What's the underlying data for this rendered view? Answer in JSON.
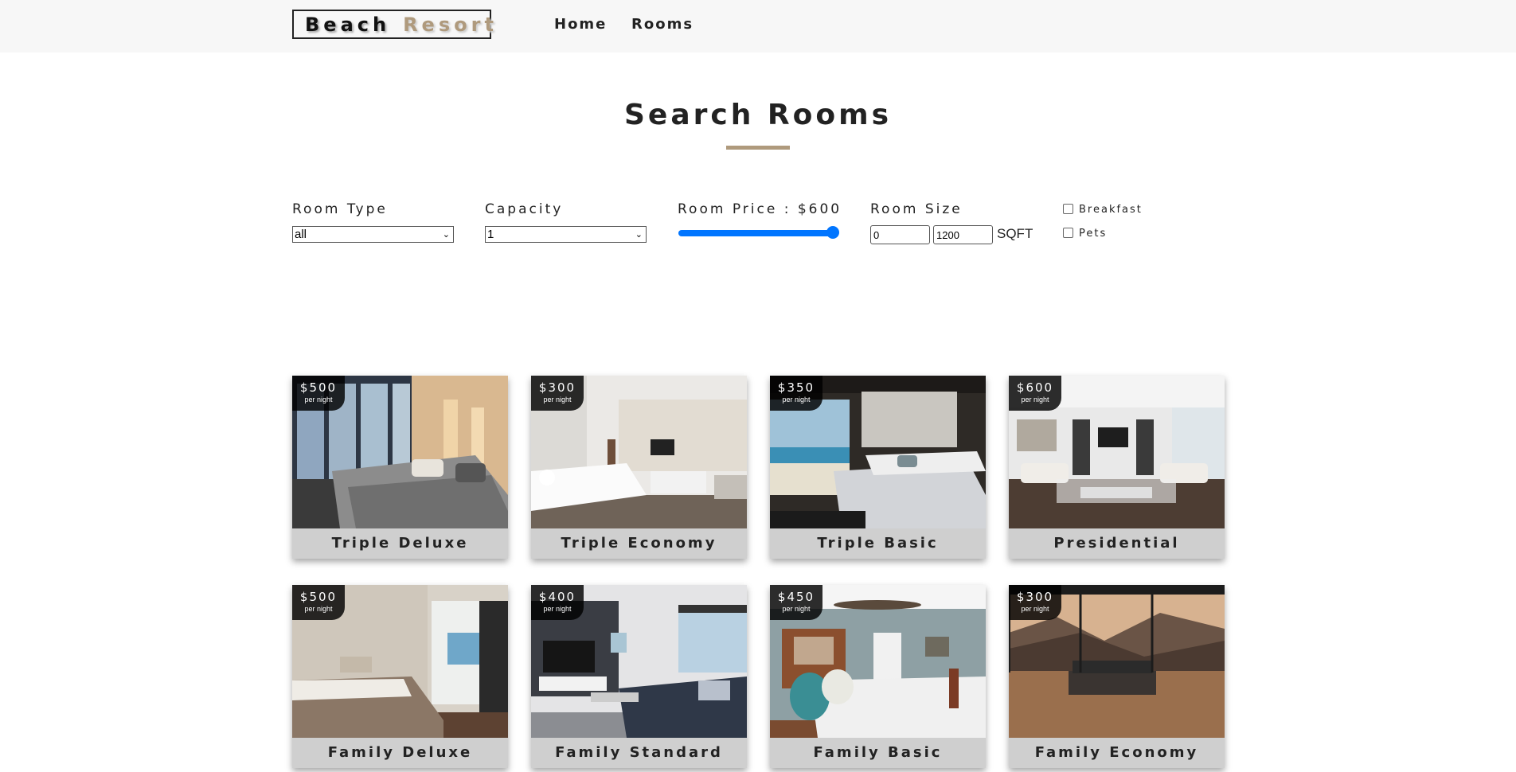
{
  "nav": {
    "logo_word1": "Beach",
    "logo_word2": "Resort",
    "links": [
      "Home",
      "Rooms"
    ]
  },
  "title": "Search Rooms",
  "filters": {
    "room_type_label": "Room Type",
    "room_type_value": "all",
    "capacity_label": "Capacity",
    "capacity_value": "1",
    "price_label": "Room Price : $600",
    "price_value": 600,
    "price_fraction": 1.0,
    "size_label": "Room Size",
    "size_min": "0",
    "size_max": "1200",
    "size_unit": "SQFT",
    "breakfast_label": "Breakfast",
    "breakfast_checked": false,
    "pets_label": "Pets",
    "pets_checked": false
  },
  "rooms": [
    {
      "name": "Triple Deluxe",
      "price": "$500",
      "per": "per night"
    },
    {
      "name": "Triple Economy",
      "price": "$300",
      "per": "per night"
    },
    {
      "name": "Triple Basic",
      "price": "$350",
      "per": "per night"
    },
    {
      "name": "Presidential",
      "price": "$600",
      "per": "per night"
    },
    {
      "name": "Family Deluxe",
      "price": "$500",
      "per": "per night"
    },
    {
      "name": "Family Standard",
      "price": "$400",
      "per": "per night"
    },
    {
      "name": "Family Basic",
      "price": "$450",
      "per": "per night"
    },
    {
      "name": "Family Economy",
      "price": "$300",
      "per": "per night"
    }
  ]
}
